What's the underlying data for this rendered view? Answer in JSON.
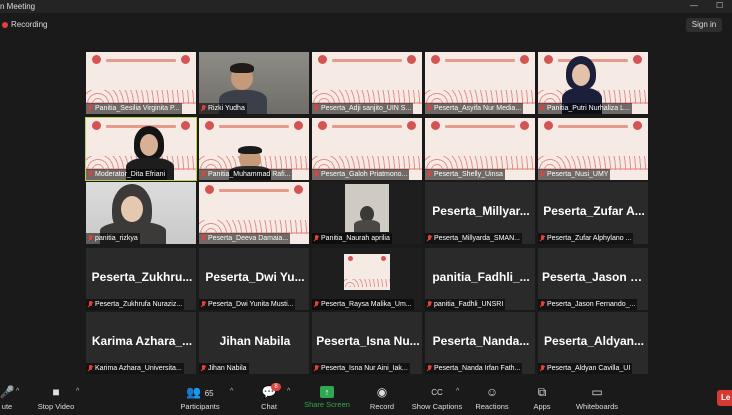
{
  "window": {
    "title": "n Meeting",
    "minimize_glyph": "—",
    "maximize_glyph": "☐"
  },
  "topbar": {
    "recording_label": "Recording",
    "signin_label": "Sign in"
  },
  "tiles": [
    {
      "label": "Panitia_Sesilia Virginita P...",
      "kind": "slide"
    },
    {
      "label": "Rizki Yudha",
      "kind": "cam-man"
    },
    {
      "label": "Peserta_Adji sanjito_UIN S...",
      "kind": "slide"
    },
    {
      "label": "Peserta_Asyifa Nur Media...",
      "kind": "slide"
    },
    {
      "label": "Panitia_Putri Nurhaliza L...",
      "kind": "cam-woman"
    },
    {
      "label": "Moderator_Dita Efriani",
      "kind": "cam-moderator"
    },
    {
      "label": "Panitia_Muhammad Rafi...",
      "kind": "cam-slide-man"
    },
    {
      "label": "Peserta_Galoh Priatmono...",
      "kind": "slide"
    },
    {
      "label": "Peserta_Shelly_Uinsa",
      "kind": "slide"
    },
    {
      "label": "Peserta_Nusi_UMY",
      "kind": "slide"
    },
    {
      "label": "panitia_rizkya",
      "kind": "cam-hijab"
    },
    {
      "label": "Peserta_Deeva Damaia...",
      "kind": "slide"
    },
    {
      "label": "Panitia_Naurah aprilia",
      "kind": "cam-small"
    },
    {
      "label": "Peserta_Millyarda_SMAN...",
      "kind": "name",
      "name": "Peserta_Millyar..."
    },
    {
      "label": "Peserta_Zufar Alphylano ...",
      "kind": "name",
      "name": "Peserta_Zufar A..."
    },
    {
      "label": "Peserta_Zukhrufa Nuraziz...",
      "kind": "name",
      "name": "Peserta_Zukhru..."
    },
    {
      "label": "Peserta_Dwi Yunita Musti...",
      "kind": "name",
      "name": "Peserta_Dwi Yu..."
    },
    {
      "label": "Peserta_Raysa Malika_Um...",
      "kind": "cam-thumb"
    },
    {
      "label": "panitia_Fadhli_UNSRI",
      "kind": "name",
      "name": "panitia_Fadhli_..."
    },
    {
      "label": "Peserta_Jason Fernando_...",
      "kind": "name",
      "name": "Peserta_Jason F..."
    },
    {
      "label": "Karima Azhara_Universita...",
      "kind": "name",
      "name": "Karima Azhara_..."
    },
    {
      "label": "Jihan Nabila",
      "kind": "name",
      "name": "Jihan Nabila"
    },
    {
      "label": "Peserta_Isna Nur Aini_Iak...",
      "kind": "name",
      "name": "Peserta_Isna Nu..."
    },
    {
      "label": "Peserta_Nanda Irfan Fath...",
      "kind": "name",
      "name": "Peserta_Nanda..."
    },
    {
      "label": "Peserta_Aldyan Cavilla_UI",
      "kind": "name",
      "name": "Peserta_Aldyan..."
    }
  ],
  "toolbar": {
    "mute": "ute",
    "stop_video": "Stop Video",
    "participants": "Participants",
    "participants_count": "65",
    "chat": "Chat",
    "chat_badge": "8",
    "share_screen": "Share Screen",
    "record": "Record",
    "show_captions": "Show Captions",
    "reactions": "Reactions",
    "apps": "Apps",
    "whiteboards": "Whiteboards",
    "leave": "Le"
  },
  "colors": {
    "active_speaker": "#b7d833",
    "share_green": "#2fa84f",
    "mute_red": "#e0433b",
    "leave_red": "#d43a32"
  },
  "icons": {
    "record_dot": "record-indicator-icon",
    "mic_muted": "mic-muted-icon"
  }
}
